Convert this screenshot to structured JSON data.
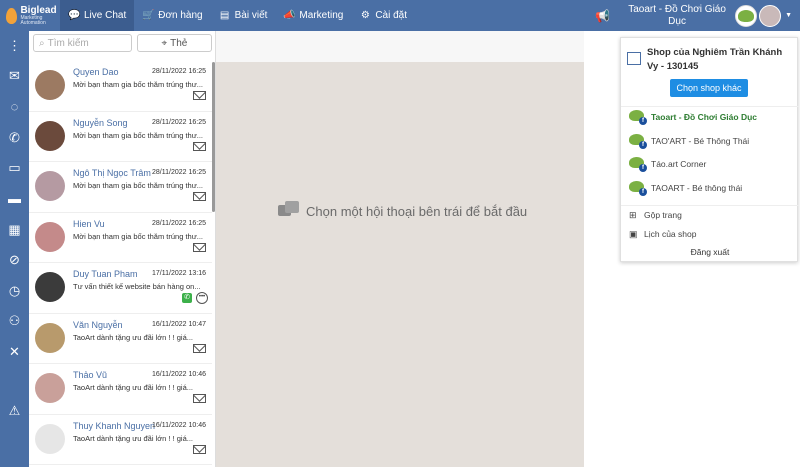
{
  "brand": {
    "name": "Biglead",
    "tagline": "Marketing Automation"
  },
  "nav": [
    {
      "label": "Live Chat",
      "icon": "chat-icon",
      "glyph": "💬",
      "active": true
    },
    {
      "label": "Đơn hàng",
      "icon": "cart-icon",
      "glyph": "🛒",
      "active": false
    },
    {
      "label": "Bài viết",
      "icon": "post-icon",
      "glyph": "▤",
      "active": false
    },
    {
      "label": "Marketing",
      "icon": "megaphone-icon",
      "glyph": "📣",
      "active": false
    },
    {
      "label": "Cài đặt",
      "icon": "gear-icon",
      "glyph": "⚙",
      "active": false
    }
  ],
  "header": {
    "shop_title": "Taoart - Đồ Chơi Giáo Dục"
  },
  "search": {
    "placeholder": "Tìm kiếm",
    "tag_label": "Thẻ"
  },
  "conversations": [
    {
      "name": "Quyen Dao",
      "time": "28/11/2022 16:25",
      "message": "Mời bạn tham gia bốc thăm trúng thư...",
      "channel": "mail",
      "color": "#9c7a62"
    },
    {
      "name": "Nguyễn Song",
      "time": "28/11/2022 16:25",
      "message": "Mời bạn tham gia bốc thăm trúng thư...",
      "channel": "mail",
      "color": "#6b4a3c"
    },
    {
      "name": "Ngô Thị Ngọc Trâm",
      "time": "28/11/2022 16:25",
      "message": "Mời bạn tham gia bốc thăm trúng thư...",
      "channel": "mail",
      "color": "#b59aa2"
    },
    {
      "name": "Hien Vu",
      "time": "28/11/2022 16:25",
      "message": "Mời bạn tham gia bốc thăm trúng thư...",
      "channel": "mail",
      "color": "#c48a8a"
    },
    {
      "name": "Duy Tuan Pham",
      "time": "17/11/2022 13:16",
      "message": "Tư vấn thiết kế website bán hàng on...",
      "channel": "phone-chat",
      "color": "#3b3b3b"
    },
    {
      "name": "Văn Nguyễn",
      "time": "16/11/2022 10:47",
      "message": "TaoArt dành tặng ưu đãi lớn ! ! giá...",
      "channel": "mail",
      "color": "#b89a6c"
    },
    {
      "name": "Thảo Vũ",
      "time": "16/11/2022 10:46",
      "message": "TaoArt dành tặng ưu đãi lớn ! ! giá...",
      "channel": "mail",
      "color": "#c9a09a"
    },
    {
      "name": "Thuy Khanh Nguyen",
      "time": "16/11/2022 10:46",
      "message": "TaoArt dành tặng ưu đãi lớn ! ! giá...",
      "channel": "mail",
      "color": "#e6e6e6"
    }
  ],
  "main": {
    "empty_message": "Chọn một hội thoại bên trái để bắt đầu"
  },
  "dropdown": {
    "shop_name": "Shop của Nghiêm Trần Khánh Vy - 130145",
    "choose_label": "Chọn shop khác",
    "pages": [
      {
        "label": "Taoart - Đồ Chơi Giáo Dục",
        "active": true
      },
      {
        "label": "TAO'ART - Bé Thông Thái",
        "active": false
      },
      {
        "label": "Táo.art Corner",
        "active": false
      },
      {
        "label": "TAOART - Bé thông thái",
        "active": false
      }
    ],
    "merge_label": "Gộp trang",
    "schedule_label": "Lịch của shop",
    "logout_label": "Đăng xuất"
  },
  "colors": {
    "primary": "#4a6fa5",
    "accent": "#1e8de3",
    "chat_bg": "#e4dfda"
  }
}
